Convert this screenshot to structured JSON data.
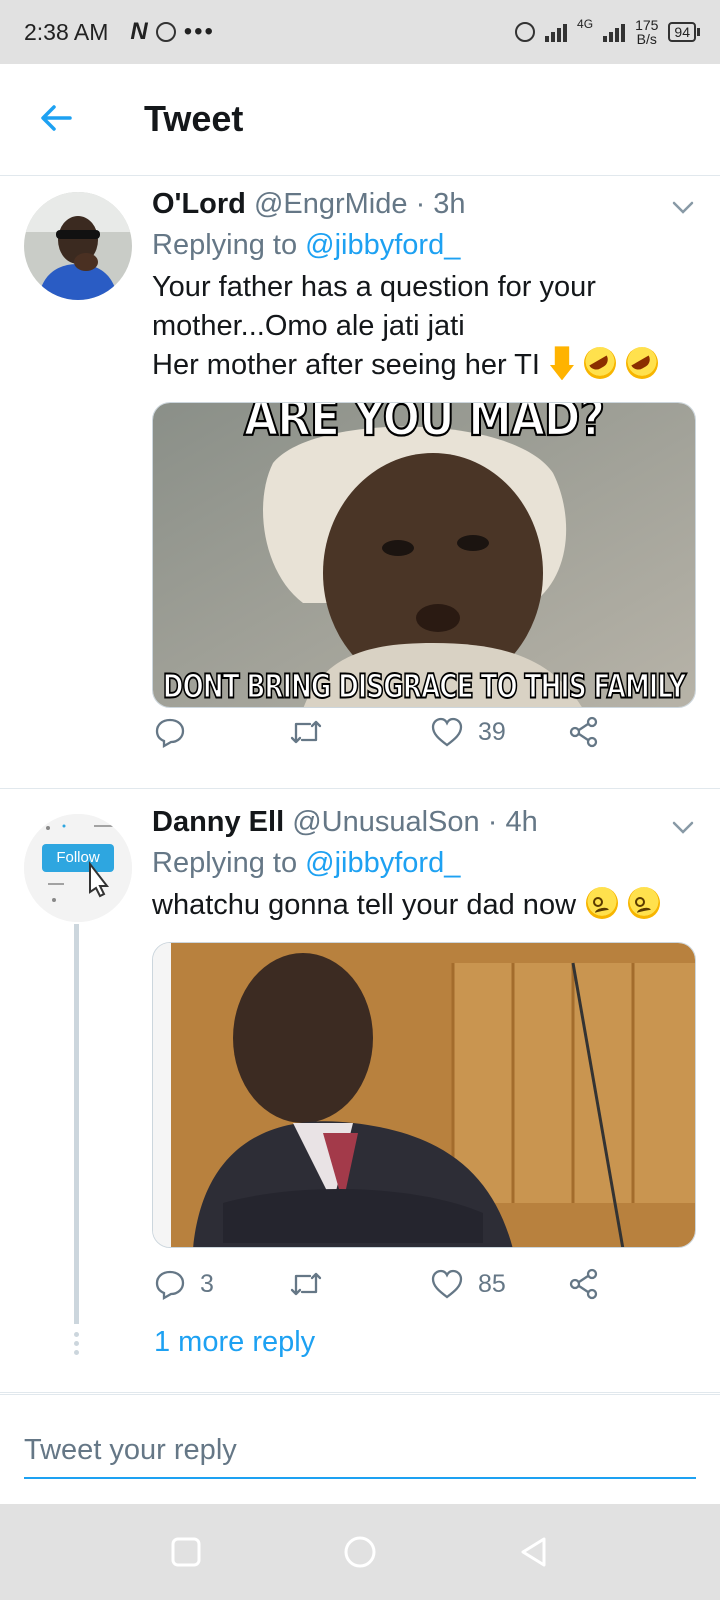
{
  "status_bar": {
    "time": "2:38 AM",
    "network_type": "4G",
    "speed_value": "175",
    "speed_unit": "B/s",
    "battery": "94"
  },
  "header": {
    "title": "Tweet"
  },
  "tweets": [
    {
      "display_name": "O'Lord",
      "handle": "@EngrMide",
      "age": "3h",
      "replying_prefix": "Replying to",
      "replying_to": "@jibbyford_",
      "text_line1": "Your father has a question for your",
      "text_line2": "mother...Omo ale jati jati",
      "text_line3": "Her mother after seeing her TI",
      "media_caption_top": "ARE YOU MAD?",
      "media_caption_bottom": "DONT BRING DISGRACE TO THIS FAMILY",
      "reply_count": "",
      "like_count": "39"
    },
    {
      "display_name": "Danny Ell",
      "handle": "@UnusualSon",
      "age": "4h",
      "replying_prefix": "Replying to",
      "replying_to": "@jibbyford_",
      "text": "whatchu gonna tell your dad now",
      "avatar_label": "Follow",
      "reply_count": "3",
      "like_count": "85"
    }
  ],
  "thread": {
    "more_replies": "1 more reply"
  },
  "reply_box": {
    "placeholder": "Tweet your reply"
  },
  "colors": {
    "accent": "#1da1f2",
    "secondary_text": "#657786",
    "divider": "#e1e8ed"
  }
}
